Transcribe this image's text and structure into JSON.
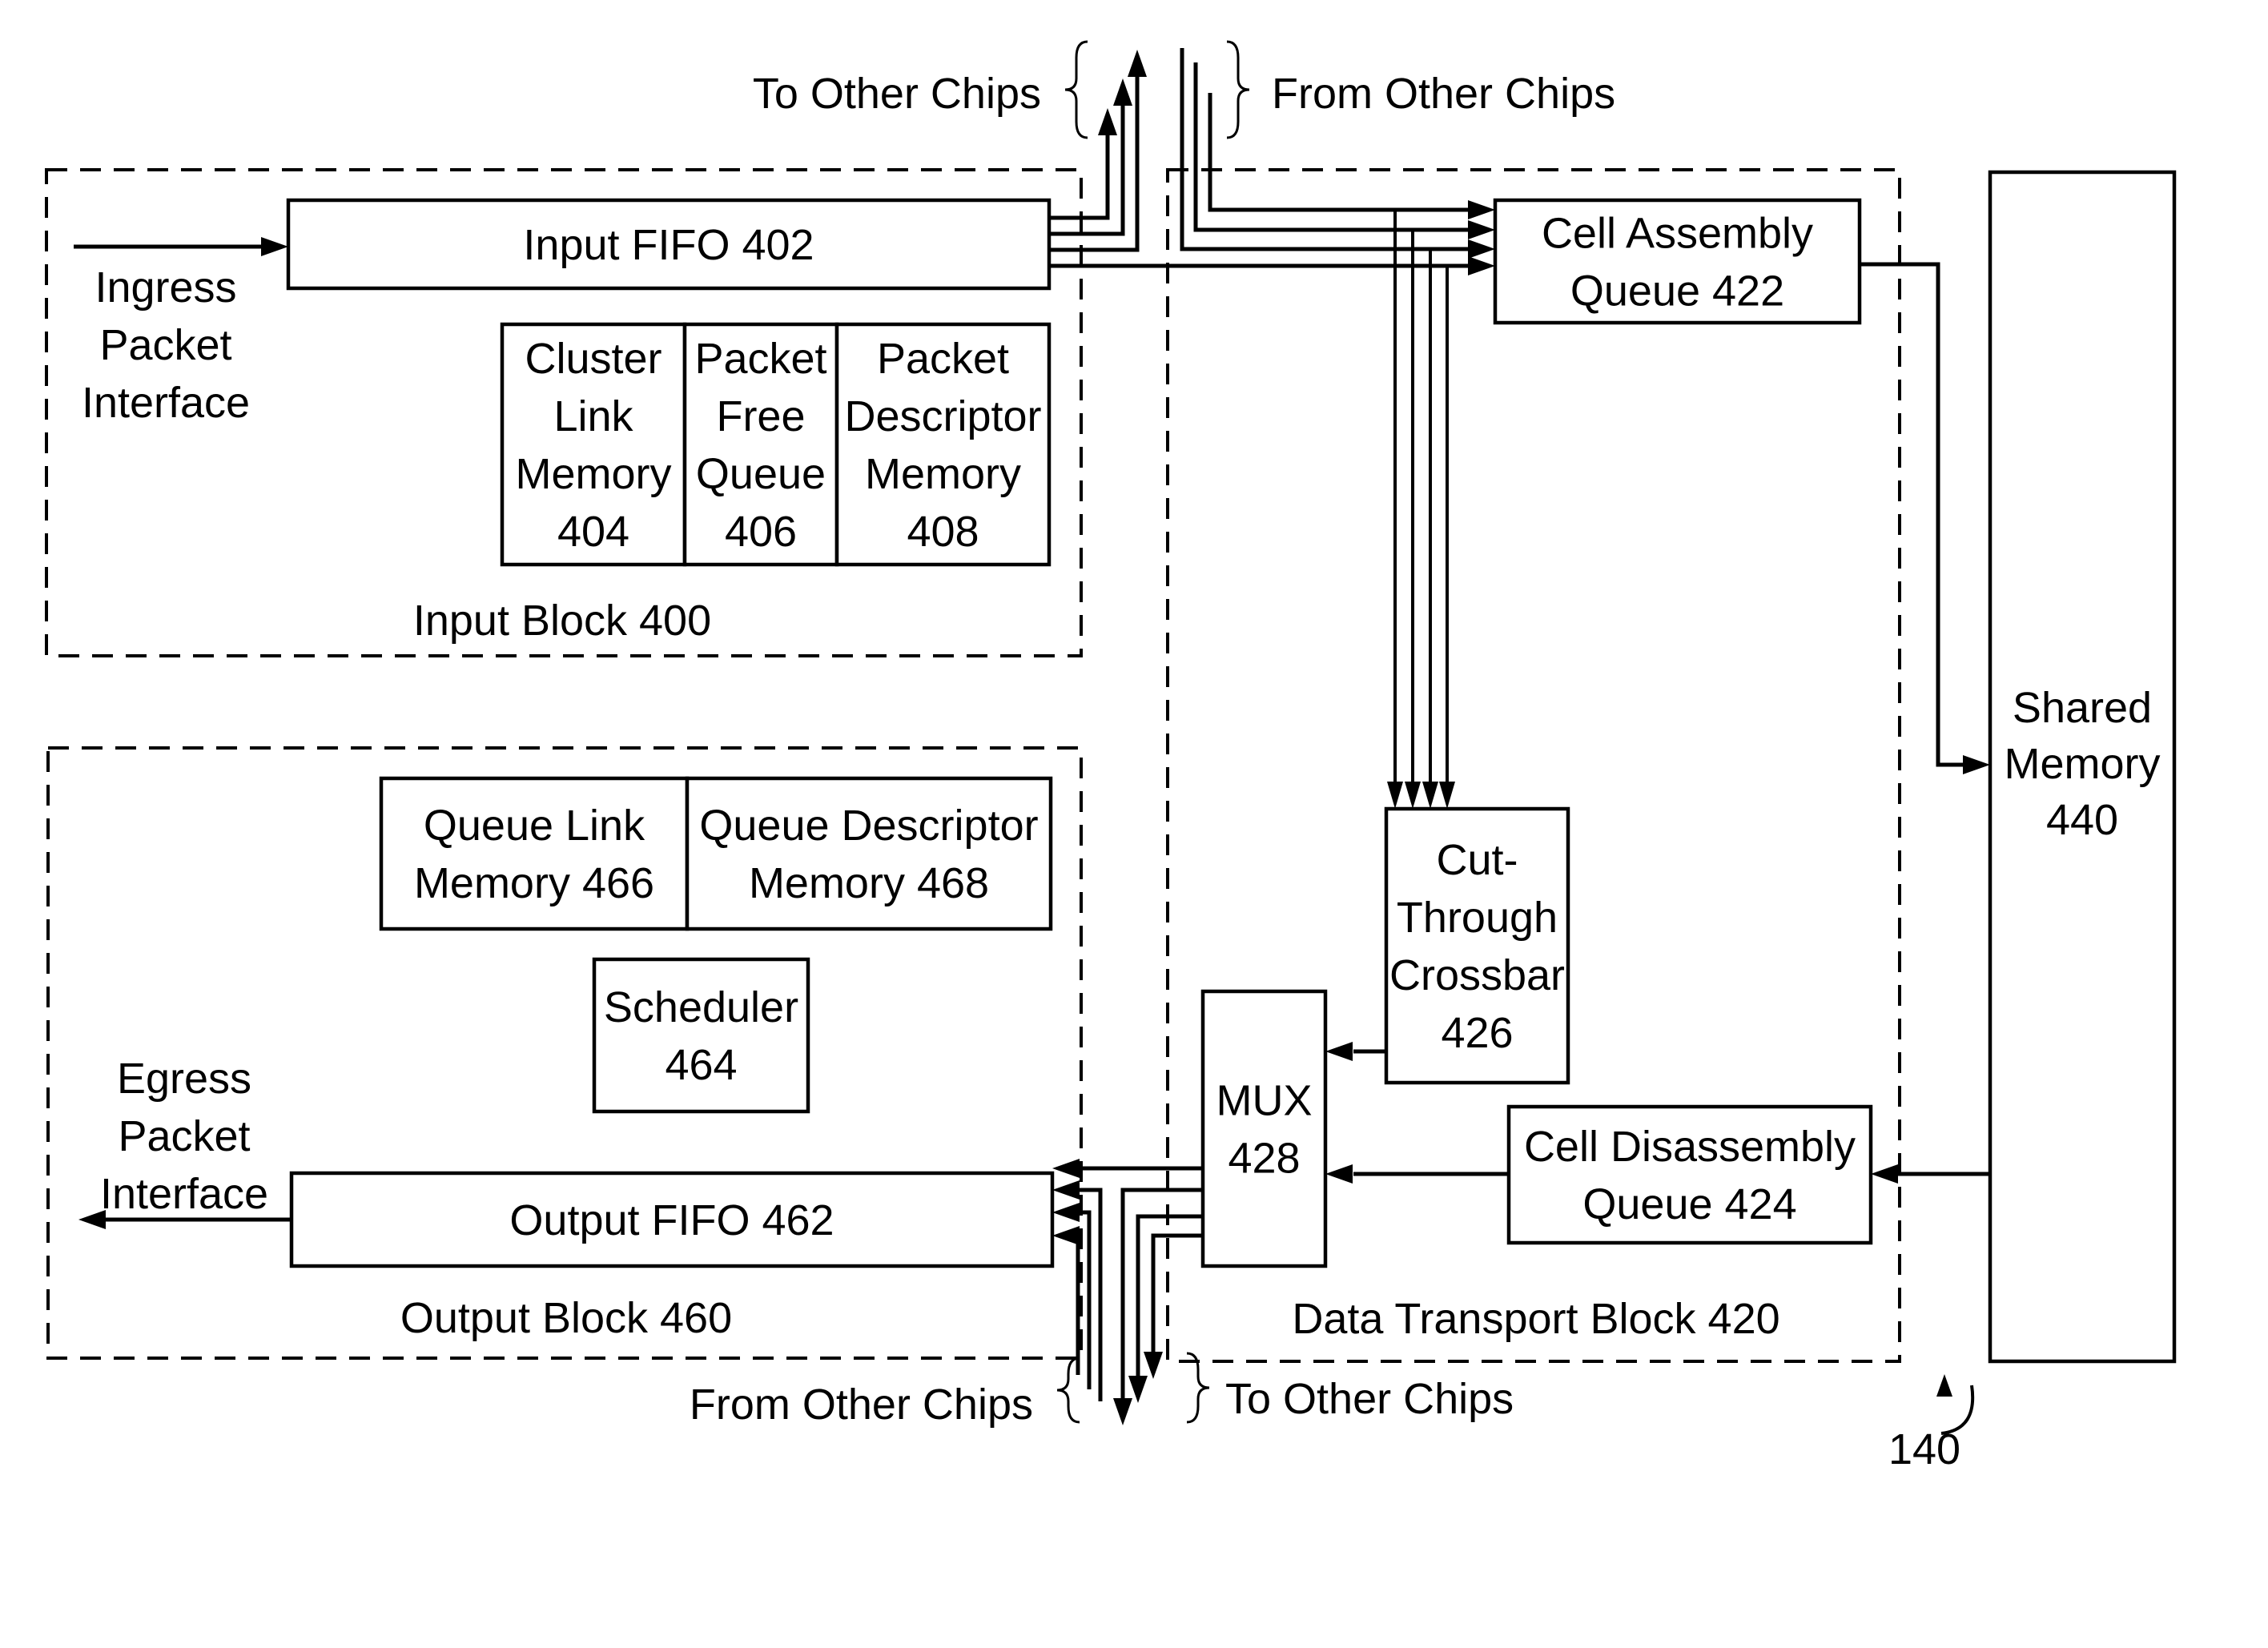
{
  "figure_ref": "140",
  "blocks": {
    "input_block": {
      "label": "Input Block 400"
    },
    "output_block": {
      "label": "Output Block 460"
    },
    "data_transport_block": {
      "label": "Data Transport Block 420"
    }
  },
  "components": {
    "input_fifo": {
      "lines": [
        "Input FIFO 402"
      ]
    },
    "cluster_link_memory": {
      "lines": [
        "Cluster",
        "Link",
        "Memory",
        "404"
      ]
    },
    "packet_free_queue": {
      "lines": [
        "Packet",
        "Free",
        "Queue",
        "406"
      ]
    },
    "packet_descriptor_memory": {
      "lines": [
        "Packet",
        "Descriptor",
        "Memory",
        "408"
      ]
    },
    "cell_assembly_queue": {
      "lines": [
        "Cell Assembly",
        "Queue 422"
      ]
    },
    "cut_through_crossbar": {
      "lines": [
        "Cut-",
        "Through",
        "Crossbar",
        "426"
      ]
    },
    "mux": {
      "lines": [
        "MUX",
        "428"
      ]
    },
    "cell_disassembly_queue": {
      "lines": [
        "Cell Disassembly",
        "Queue 424"
      ]
    },
    "shared_memory": {
      "lines": [
        "Shared",
        "Memory",
        "440"
      ]
    },
    "queue_link_memory": {
      "lines": [
        "Queue Link",
        "Memory 466"
      ]
    },
    "queue_descriptor_memory": {
      "lines": [
        "Queue Descriptor",
        "Memory 468"
      ]
    },
    "scheduler": {
      "lines": [
        "Scheduler",
        "464"
      ]
    },
    "output_fifo": {
      "lines": [
        "Output FIFO 462"
      ]
    }
  },
  "interfaces": {
    "ingress": {
      "lines": [
        "Ingress",
        "Packet",
        "Interface"
      ]
    },
    "egress": {
      "lines": [
        "Egress",
        "Packet",
        "Interface"
      ]
    }
  },
  "chip_links": {
    "top_to": "To Other Chips",
    "top_from": "From Other Chips",
    "bottom_from": "From Other Chips",
    "bottom_to": "To Other Chips"
  }
}
